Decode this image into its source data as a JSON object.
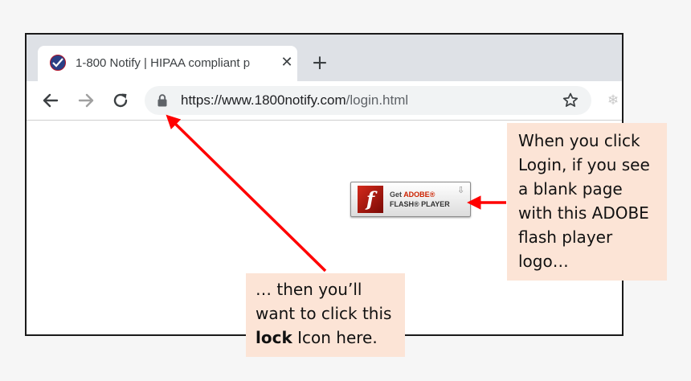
{
  "browser": {
    "tab": {
      "title": "1-800 Notify | HIPAA compliant p",
      "close_glyph": "✕"
    },
    "new_tab_glyph": "+",
    "toolbar": {
      "address": {
        "scheme_host": "https://www.1800notify.com",
        "path": "/login.html"
      }
    }
  },
  "flash_badge": {
    "get": "Get",
    "brand": "ADOBE®",
    "product": "FLASH® PLAYER"
  },
  "callouts": {
    "right": "When you click Login, if you see a blank page with this ADOBE flash player logo…",
    "bottom": {
      "before": "… then you’ll want to click this",
      "emphasis": "lock",
      "after": "Icon here."
    }
  },
  "colors": {
    "arrow": "#ff0000",
    "callout_background": "#fce4d6",
    "tabstrip": "#dee1e6",
    "omnibox": "#f1f3f4"
  },
  "icons": [
    "back-arrow-icon",
    "forward-arrow-icon",
    "reload-icon",
    "lock-icon",
    "star-icon",
    "extension-icon",
    "flash-logo-icon",
    "download-icon"
  ]
}
